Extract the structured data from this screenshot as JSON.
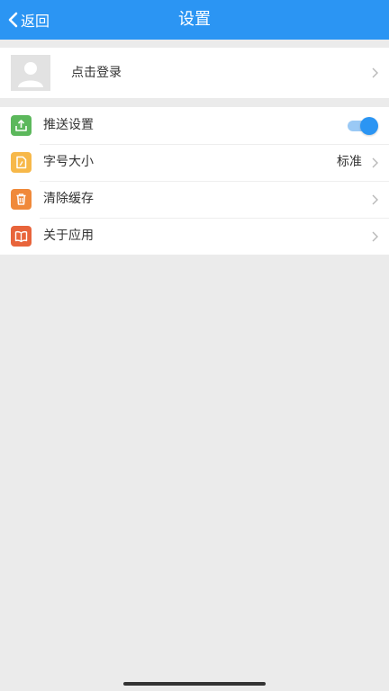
{
  "navbar": {
    "back_label": "返回",
    "title": "设置",
    "color": "#2b95f3"
  },
  "login": {
    "label": "点击登录",
    "avatar_icon": "avatar-placeholder-icon"
  },
  "menu": {
    "push": {
      "label": "推送设置",
      "icon": "upload-icon",
      "icon_color": "#5cb85c",
      "enabled": true
    },
    "font_size": {
      "label": "字号大小",
      "value": "标准",
      "icon": "document-icon",
      "icon_color": "#f7b849"
    },
    "clear_cache": {
      "label": "清除缓存",
      "icon": "trash-icon",
      "icon_color": "#f0893a"
    },
    "about": {
      "label": "关于应用",
      "icon": "book-icon",
      "icon_color": "#e8643b"
    }
  },
  "colors": {
    "background": "#ebebeb",
    "card": "#ffffff",
    "toggle_on": "#2b95f3"
  }
}
